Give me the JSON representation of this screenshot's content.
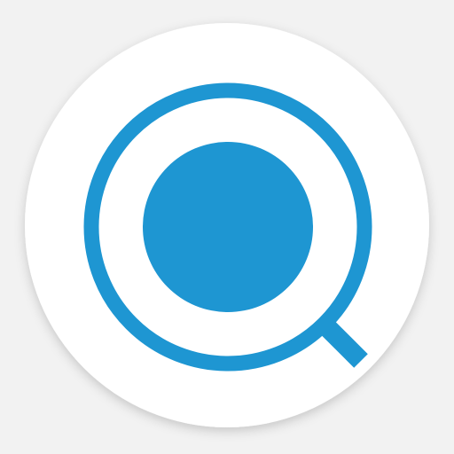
{
  "app_icon": {
    "icon": "magnifier-dot-icon",
    "colors": {
      "page_background": "#f2f2f2",
      "badge_background": "#ffffff",
      "accent": "#1e96d2"
    }
  }
}
